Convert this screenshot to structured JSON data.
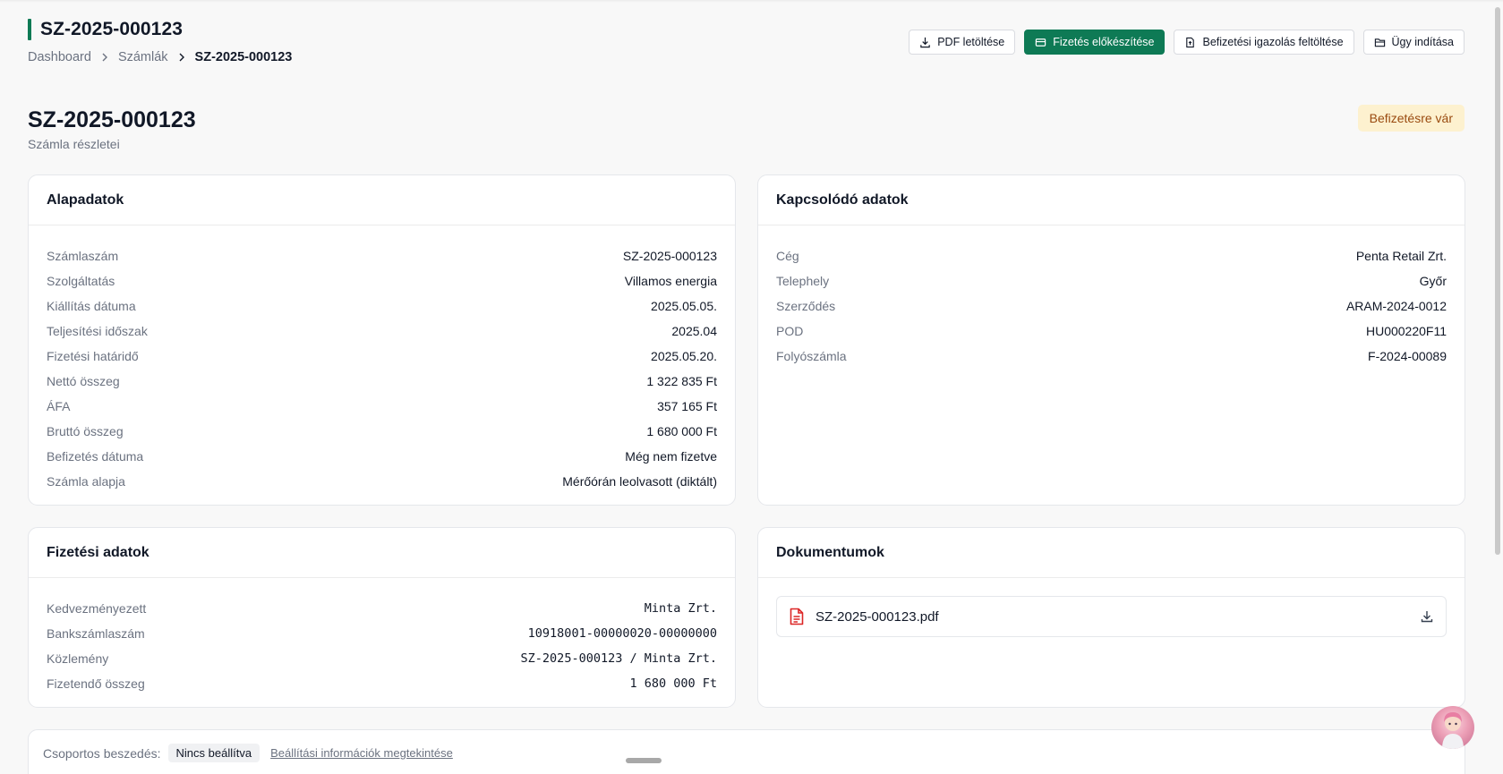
{
  "header": {
    "title": "SZ-2025-000123",
    "breadcrumb": [
      "Dashboard",
      "Számlák",
      "SZ-2025-000123"
    ]
  },
  "actions": {
    "pdf": "PDF letöltése",
    "payment": "Fizetés előkészítése",
    "upload": "Befizetési igazolás feltöltése",
    "case": "Ügy indítása"
  },
  "page": {
    "title": "SZ-2025-000123",
    "subtitle": "Számla részletei",
    "status": "Befizetésre vár"
  },
  "basic": {
    "title": "Alapadatok",
    "rows": [
      {
        "k": "Számlaszám",
        "v": "SZ-2025-000123"
      },
      {
        "k": "Szolgáltatás",
        "v": "Villamos energia"
      },
      {
        "k": "Kiállítás dátuma",
        "v": "2025.05.05."
      },
      {
        "k": "Teljesítési időszak",
        "v": "2025.04"
      },
      {
        "k": "Fizetési határidő",
        "v": "2025.05.20."
      },
      {
        "k": "Nettó összeg",
        "v": "1 322 835 Ft"
      },
      {
        "k": "ÁFA",
        "v": "357 165 Ft"
      },
      {
        "k": "Bruttó összeg",
        "v": "1 680 000 Ft"
      },
      {
        "k": "Befizetés dátuma",
        "v": "Még nem fizetve"
      },
      {
        "k": "Számla alapja",
        "v": "Mérőórán leolvasott (diktált)"
      }
    ]
  },
  "related": {
    "title": "Kapcsolódó adatok",
    "rows": [
      {
        "k": "Cég",
        "v": "Penta Retail Zrt."
      },
      {
        "k": "Telephely",
        "v": "Győr"
      },
      {
        "k": "Szerződés",
        "v": "ARAM-2024-0012"
      },
      {
        "k": "POD",
        "v": "HU000220F11"
      },
      {
        "k": "Folyószámla",
        "v": "F-2024-00089"
      }
    ]
  },
  "payment": {
    "title": "Fizetési adatok",
    "rows": [
      {
        "k": "Kedvezményezett",
        "v": "Minta Zrt."
      },
      {
        "k": "Bankszámlaszám",
        "v": "10918001-00000020-00000000"
      },
      {
        "k": "Közlemény",
        "v": "SZ-2025-000123 / Minta Zrt."
      },
      {
        "k": "Fizetendő összeg",
        "v": "1 680 000 Ft"
      }
    ]
  },
  "documents": {
    "title": "Dokumentumok",
    "items": [
      {
        "name": "SZ-2025-000123.pdf"
      }
    ]
  },
  "group": {
    "label": "Csoportos beszedés:",
    "value": "Nincs beállítva",
    "link": "Beállítási információk megtekintése"
  },
  "colors": {
    "primary": "#0e7a55",
    "badge_bg": "#fdf1cf",
    "badge_text": "#9a4b10",
    "pdf_icon": "#dc2626"
  },
  "icons": [
    "chevron-right-icon",
    "download-icon",
    "credit-card-icon",
    "file-upload-icon",
    "folder-icon",
    "pdf-file-icon"
  ]
}
